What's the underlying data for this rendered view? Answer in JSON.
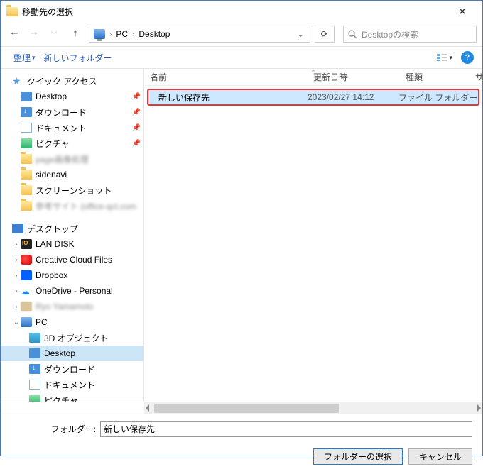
{
  "window": {
    "title": "移動先の選択"
  },
  "path": {
    "root": "PC",
    "current": "Desktop"
  },
  "search": {
    "placeholder": "Desktopの検索"
  },
  "toolbar": {
    "organize": "整理",
    "newfolder": "新しいフォルダー"
  },
  "columns": {
    "name": "名前",
    "date": "更新日時",
    "type": "種類",
    "size": "サ"
  },
  "files": [
    {
      "name": "新しい保存先",
      "date": "2023/02/27 14:12",
      "type": "ファイル フォルダー"
    }
  ],
  "sidebar": {
    "quick": "クイック アクセス",
    "quick_items": [
      "Desktop",
      "ダウンロード",
      "ドキュメント",
      "ピクチャ",
      "",
      "sidenavi",
      "スクリーンショット",
      ""
    ],
    "desktop": "デスクトップ",
    "desktop_items": [
      "LAN DISK",
      "Creative Cloud Files",
      "Dropbox",
      "OneDrive - Personal",
      ""
    ],
    "pc": "PC",
    "pc_items": [
      "3D オブジェクト",
      "Desktop",
      "ダウンロード",
      "ドキュメント",
      "ピクチャ"
    ]
  },
  "folder": {
    "label": "フォルダー:",
    "value": "新しい保存先"
  },
  "buttons": {
    "select": "フォルダーの選択",
    "cancel": "キャンセル"
  }
}
